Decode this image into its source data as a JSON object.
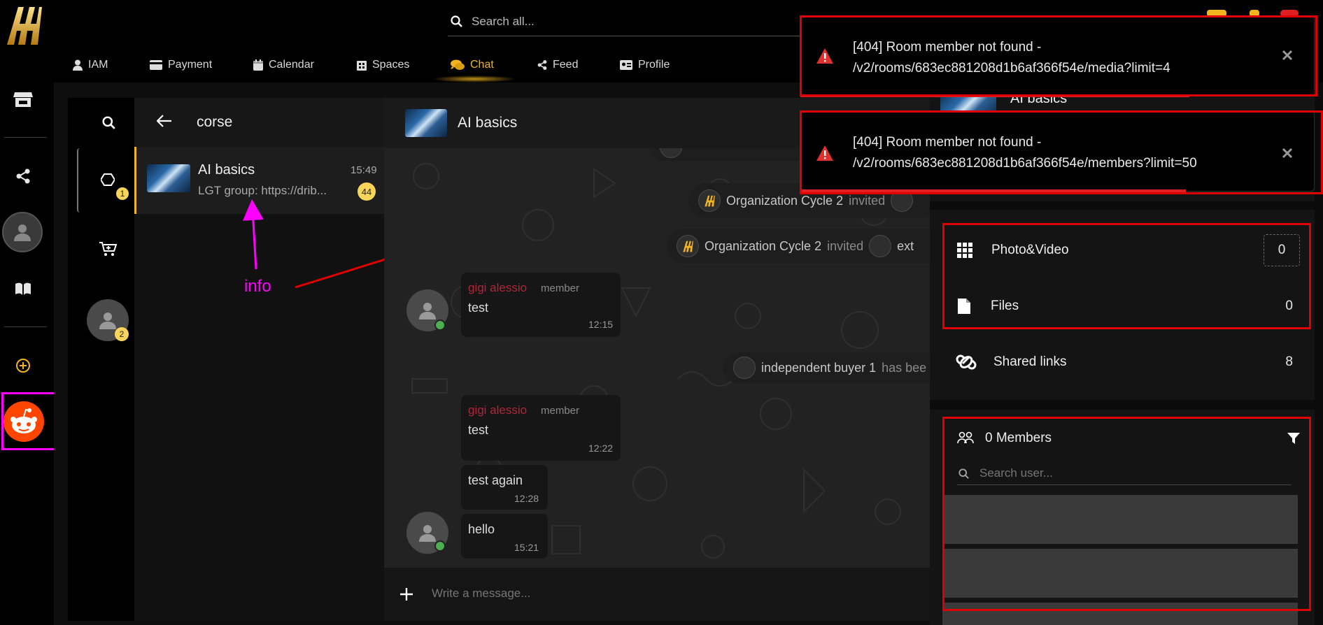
{
  "colors": {
    "accent": "#f2b51f",
    "danger": "#e00000",
    "annotation": "#ff00ff",
    "online": "#4caf50",
    "sender": "#b3253b"
  },
  "search": {
    "placeholder": "Search all..."
  },
  "nav": {
    "items": [
      {
        "label": "IAM",
        "icon": "user-icon"
      },
      {
        "label": "Payment",
        "icon": "credit-card-icon"
      },
      {
        "label": "Calendar",
        "icon": "calendar-icon"
      },
      {
        "label": "Spaces",
        "icon": "building-icon"
      },
      {
        "label": "Chat",
        "icon": "chat-icon",
        "active": true
      },
      {
        "label": "Feed",
        "icon": "share-icon"
      },
      {
        "label": "Profile",
        "icon": "id-card-icon"
      }
    ]
  },
  "spaces": {
    "badge_1": "1",
    "badge_2": "2"
  },
  "list": {
    "title": "corse"
  },
  "room": {
    "name": "AI basics",
    "time": "15:49",
    "preview": "LGT group: https://drib...",
    "unread": "44"
  },
  "annotation": {
    "label": "info"
  },
  "chat": {
    "title": "AI basics",
    "system": [
      {
        "actor": "Organization Cycle 2",
        "action": "invited"
      },
      {
        "actor": "Organization Cycle 2",
        "action": "invited",
        "target": "ext"
      },
      {
        "actor": "independent buyer 1",
        "action": "has bee"
      }
    ],
    "messages": [
      {
        "sender": "gigi alessio",
        "role": "member",
        "text": "test",
        "time": "12:15"
      },
      {
        "sender": "gigi alessio",
        "role": "member",
        "text": "test",
        "time": "12:22"
      },
      {
        "text": "test again",
        "time": "12:28"
      },
      {
        "text": "hello",
        "time": "15:21"
      }
    ],
    "composer_placeholder": "Write a message..."
  },
  "info_panel": {
    "room_name": "AI basics",
    "media": [
      {
        "label": "Photo&Video",
        "count": "0",
        "icon": "grid-icon"
      },
      {
        "label": "Files",
        "count": "0",
        "icon": "file-icon"
      },
      {
        "label": "Shared links",
        "count": "8",
        "icon": "link-icon"
      }
    ],
    "members": {
      "title": "0 Members",
      "search_placeholder": "Search user..."
    }
  },
  "toasts": [
    {
      "line1": "[404] Room member not found -",
      "line2": "/v2/rooms/683ec881208d1b6af366f54e/media?limit=4"
    },
    {
      "line1": "[404] Room member not found -",
      "line2": "/v2/rooms/683ec881208d1b6af366f54e/members?limit=50"
    }
  ]
}
